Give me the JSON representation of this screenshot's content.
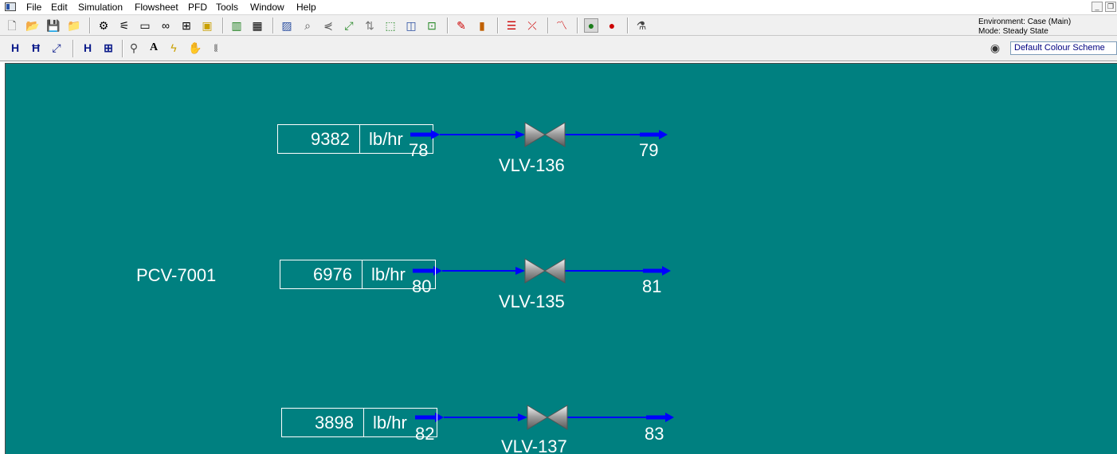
{
  "menu": {
    "items": [
      "File",
      "Edit",
      "Simulation",
      "Flowsheet",
      "PFD",
      "Tools",
      "Window",
      "Help"
    ]
  },
  "environment": {
    "line1": "Environment: Case (Main)",
    "line2": "Mode: Steady State"
  },
  "colour_scheme": {
    "value": "Default Colour Scheme"
  },
  "pfd": {
    "title_label": "PCV-7001",
    "units": [
      {
        "flow_value": "9382",
        "flow_unit": "lb/hr",
        "inlet": "78",
        "outlet": "79",
        "valve": "VLV-136"
      },
      {
        "flow_value": "6976",
        "flow_unit": "lb/hr",
        "inlet": "80",
        "outlet": "81",
        "valve": "VLV-135"
      },
      {
        "flow_value": "3898",
        "flow_unit": "lb/hr",
        "inlet": "82",
        "outlet": "83",
        "valve": "VLV-137"
      }
    ]
  },
  "colors": {
    "canvas": "#008080",
    "stream": "#0000ff",
    "label": "#ffffff"
  }
}
